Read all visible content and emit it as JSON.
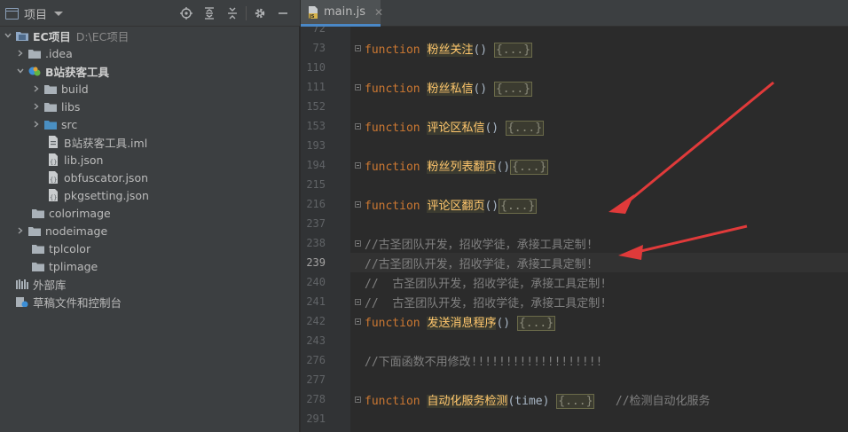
{
  "project_panel": {
    "title": "项目",
    "tools": [
      "locate-icon",
      "expand-all-icon",
      "collapse-all-icon",
      "gear-icon",
      "minimize-icon"
    ],
    "tree": [
      {
        "label": "EC项目",
        "note": "D:\\EC项目",
        "kind": "project"
      },
      {
        "label": ".idea",
        "kind": "folder"
      },
      {
        "label": "B站获客工具",
        "kind": "module"
      },
      {
        "label": "build",
        "kind": "folder"
      },
      {
        "label": "libs",
        "kind": "folder"
      },
      {
        "label": "src",
        "kind": "folder"
      },
      {
        "label": "B站获客工具.iml",
        "kind": "file"
      },
      {
        "label": "lib.json",
        "kind": "file"
      },
      {
        "label": "obfuscator.json",
        "kind": "file"
      },
      {
        "label": "pkgsetting.json",
        "kind": "file"
      },
      {
        "label": "colorimage",
        "kind": "folder"
      },
      {
        "label": "nodeimage",
        "kind": "folder"
      },
      {
        "label": "tplcolor",
        "kind": "folder"
      },
      {
        "label": "tplimage",
        "kind": "folder"
      },
      {
        "label": "外部库",
        "kind": "library"
      },
      {
        "label": "草稿文件和控制台",
        "kind": "scratch"
      }
    ]
  },
  "editor": {
    "tab_label": "main.js",
    "line_numbers": [
      "72",
      "73",
      "110",
      "111",
      "152",
      "153",
      "193",
      "194",
      "215",
      "216",
      "237",
      "238",
      "239",
      "240",
      "241",
      "242",
      "243",
      "276",
      "277",
      "278",
      "291"
    ],
    "current_line": "239",
    "keyword": "function",
    "fold_placeholder": "{...}",
    "functions": [
      "粉丝关注",
      "粉丝私信",
      "评论区私信",
      "粉丝列表翻页",
      "评论区翻页",
      "发送消息程序",
      "自动化服务检测"
    ],
    "paren_empty": "()",
    "paren_time": "(time)",
    "comments": [
      "//古圣团队开发，招收学徒，承接工具定制!",
      "//古圣团队开发，招收学徒，承接工具定制!",
      "//  古圣团队开发，招收学徒，承接工具定制!",
      "//  古圣团队开发，招收学徒，承接工具定制!",
      "//下面函数不用修改!!!!!!!!!!!!!!!!!!!",
      "//检测自动化服务"
    ]
  },
  "colors": {
    "arrow": "#e03a3a",
    "keyword": "#cc7832",
    "function_name": "#ffc66d",
    "comment": "#808080"
  }
}
